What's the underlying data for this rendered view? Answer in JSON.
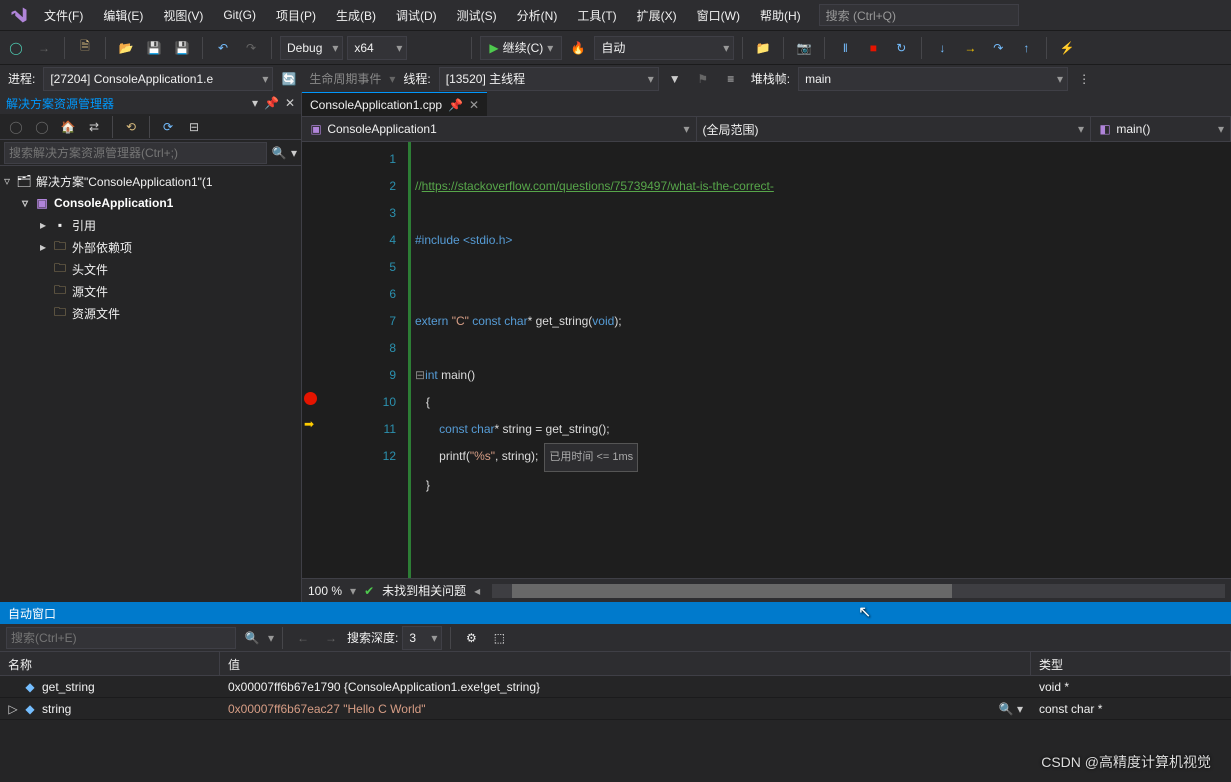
{
  "menu": {
    "items": [
      "文件(F)",
      "编辑(E)",
      "视图(V)",
      "Git(G)",
      "项目(P)",
      "生成(B)",
      "调试(D)",
      "测试(S)",
      "分析(N)",
      "工具(T)",
      "扩展(X)",
      "窗口(W)",
      "帮助(H)"
    ],
    "search_placeholder": "搜索 (Ctrl+Q)"
  },
  "toolbar": {
    "config": "Debug",
    "platform": "x64",
    "continue_label": "继续(C)",
    "startup": "自动"
  },
  "debugbar": {
    "process_label": "进程:",
    "process_value": "[27204] ConsoleApplication1.e",
    "lifecycle": "生命周期事件",
    "thread_label": "线程:",
    "thread_value": "[13520] 主线程",
    "stackframe_label": "堆栈帧:",
    "stackframe_value": "main"
  },
  "solution_explorer": {
    "title": "解决方案资源管理器",
    "search_placeholder": "搜索解决方案资源管理器(Ctrl+;)",
    "root": "解决方案\"ConsoleApplication1\"(1",
    "project": "ConsoleApplication1",
    "nodes": [
      "引用",
      "外部依赖项",
      "头文件",
      "源文件",
      "资源文件"
    ]
  },
  "editor": {
    "tab": "ConsoleApplication1.cpp",
    "nav_project": "ConsoleApplication1",
    "nav_scope": "(全局范围)",
    "nav_func": "main()",
    "lines": [
      "1",
      "2",
      "3",
      "4",
      "5",
      "6",
      "7",
      "8",
      "9",
      "10",
      "11",
      "12"
    ],
    "url": "https://stackoverflow.com/questions/75739497/what-is-the-correct-",
    "include": "#include <stdio.h>",
    "extern_line": {
      "p1": "extern ",
      "p2": "\"C\"",
      "p3": " const char",
      "p4": "* ",
      "p5": "get_string",
      "p6": "(",
      "p7": "void",
      "p8": ");"
    },
    "main_line": {
      "p1": "int ",
      "p2": "main",
      "p3": "()"
    },
    "l10": {
      "p1": "    const char",
      "p2": "* string = ",
      "p3": "get_string",
      "p4": "();"
    },
    "l11": {
      "p1": "    ",
      "p2": "printf",
      "p3": "(",
      "p4": "\"%s\"",
      "p5": ", string);"
    },
    "perf": "已用时间 <= 1ms",
    "zoom": "100 %",
    "status": "未找到相关问题"
  },
  "autos": {
    "title": "自动窗口",
    "search_placeholder": "搜索(Ctrl+E)",
    "depth_label": "搜索深度:",
    "depth_value": "3",
    "headers": {
      "name": "名称",
      "value": "值",
      "type": "类型"
    },
    "rows": [
      {
        "name": "get_string",
        "value": "0x00007ff6b67e1790 {ConsoleApplication1.exe!get_string}",
        "type": "void *",
        "exp": ""
      },
      {
        "name": "string",
        "value": "0x00007ff6b67eac27 \"Hello C World\"",
        "type": "const char *",
        "exp": "▷"
      }
    ]
  },
  "watermark": "CSDN @高精度计算机视觉"
}
